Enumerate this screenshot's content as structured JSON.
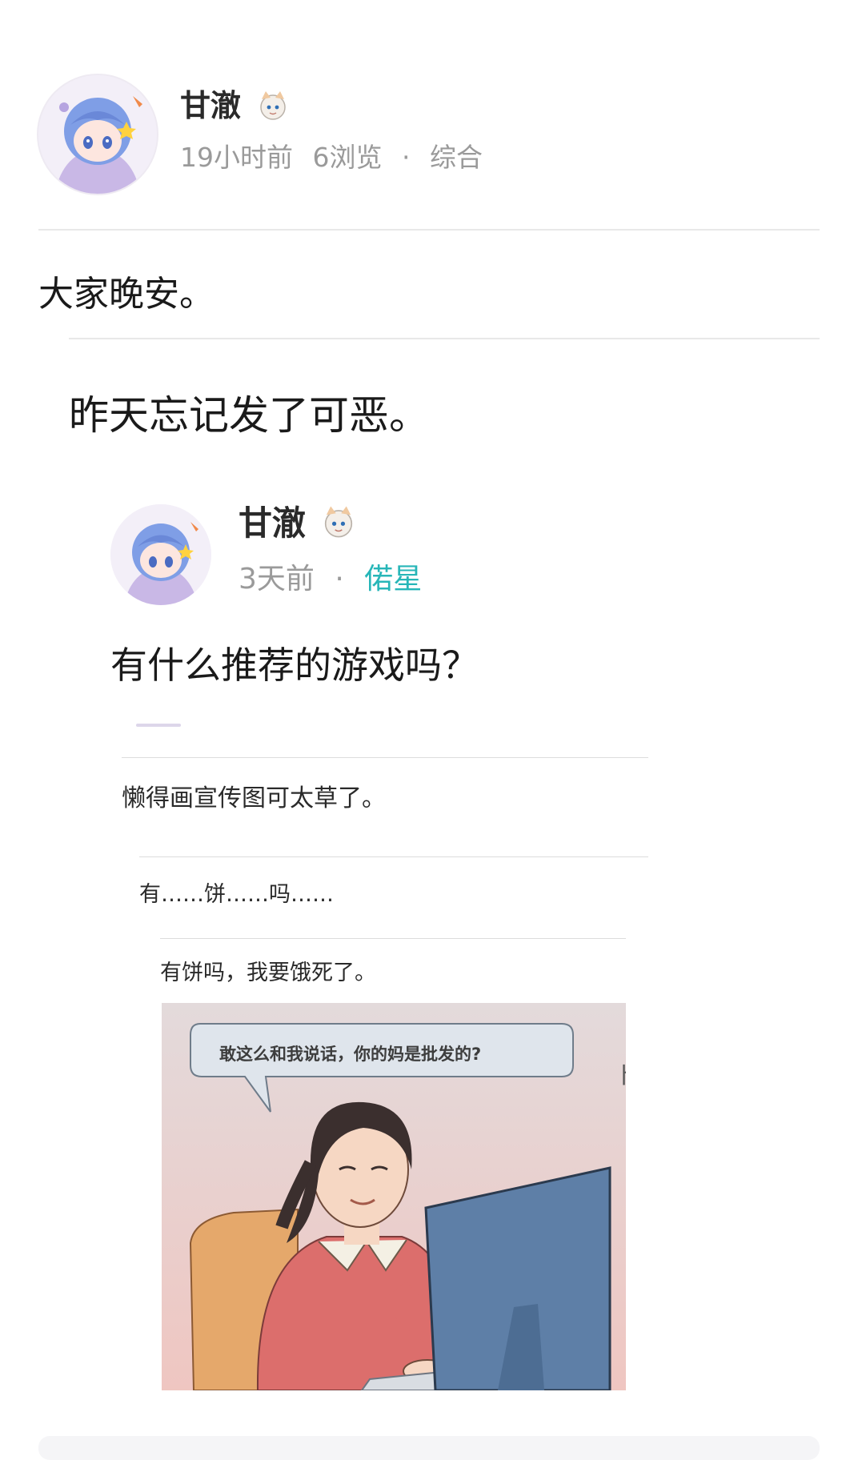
{
  "post": {
    "author": "甘澈",
    "time": "19小时前",
    "views": "6浏览",
    "separator": "·",
    "category": "综合",
    "body": "大家晚安。"
  },
  "embedded": {
    "caption": "昨天忘记发了可恶。",
    "author": "甘澈",
    "time": "3天前",
    "separator": "·",
    "channel": "偌星",
    "title": "有什么推荐的游戏吗？",
    "comments": [
      "懒得画宣传图可太草了。",
      "有……饼……吗……",
      "有饼吗，我要饿死了。"
    ],
    "meme_bubble": "敢这么和我说话，你的妈是批发的?"
  },
  "colors": {
    "accent": "#27b6b8",
    "meta": "#9a9a9a",
    "avatar_hair": "#7f9ee6"
  },
  "icons": {
    "author_badge": "chibi-badge-icon",
    "avatar": "anime-avatar"
  }
}
